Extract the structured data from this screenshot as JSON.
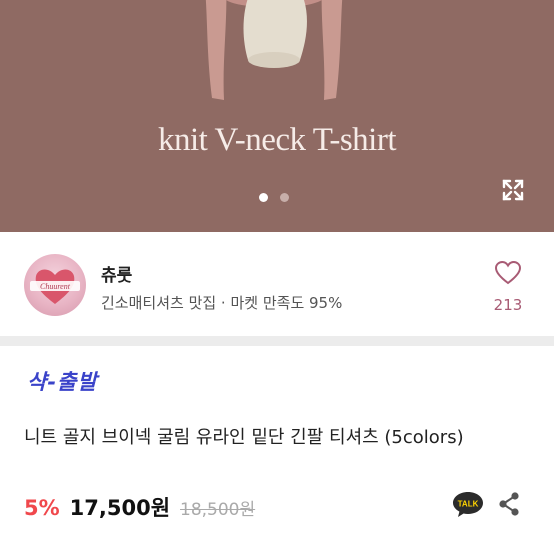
{
  "hero": {
    "title": "knit V-neck T-shirt",
    "slide_count": 2,
    "active_slide": 1,
    "background_color": "#8f6a63"
  },
  "seller": {
    "avatar_text": "Chuurent",
    "name": "츄룻",
    "description": "긴소매티셔츠 맛집 · 마켓 만족도 95%",
    "like_count": "213"
  },
  "product": {
    "brand_text": "샥-출발",
    "title": "니트 골지 브이넥 굴림 유라인 밑단 긴팔 티셔츠 (5colors)",
    "discount": "5%",
    "price": "17,500원",
    "original_price": "18,500원"
  },
  "actions": {
    "talk_label": "TALK"
  },
  "icons": [
    "expand-icon",
    "heart-icon",
    "kakao-talk-icon",
    "share-icon"
  ],
  "colors": {
    "accent_discount": "#f0484c",
    "brand": "#3a43c9",
    "like": "#a85b74"
  }
}
